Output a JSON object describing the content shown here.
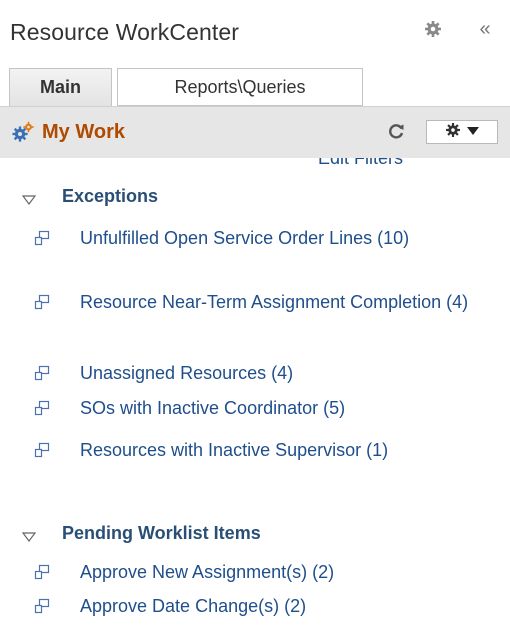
{
  "header": {
    "title": "Resource WorkCenter",
    "settings_icon": "gear-icon",
    "collapse_icon": "double-chevron-left-icon",
    "collapse_glyph": "«"
  },
  "tabs": [
    {
      "label": "Main",
      "selected": true
    },
    {
      "label": "Reports\\Queries",
      "selected": false
    }
  ],
  "my_work": {
    "title": "My Work",
    "icon": "gears-icon",
    "refresh_icon": "refresh-icon",
    "actions_icon": "gear-dropdown-icon",
    "edit_filters_label": "Edit Filters"
  },
  "sections": [
    {
      "title": "Exceptions",
      "expanded": true,
      "items": [
        {
          "label": "Unfulfilled Open Service Order Lines (10)"
        },
        {
          "label": "Resource Near-Term Assignment Completion (4)"
        },
        {
          "label": "Unassigned Resources (4)"
        },
        {
          "label": "SOs with Inactive Coordinator (5)"
        },
        {
          "label": "Resources with Inactive Supervisor (1)"
        }
      ]
    },
    {
      "title": "Pending Worklist Items",
      "expanded": true,
      "items": [
        {
          "label": "Approve New Assignment(s) (2)"
        },
        {
          "label": "Approve Date Change(s) (2)"
        }
      ]
    }
  ],
  "colors": {
    "link": "#1f4e8c",
    "section_title": "#2a4f76",
    "my_work_title": "#b04a00",
    "bar_background": "#e6e6e6"
  }
}
